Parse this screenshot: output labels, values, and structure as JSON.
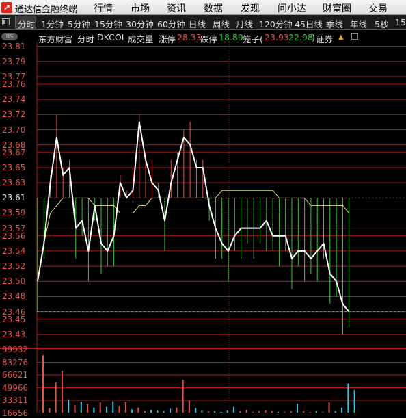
{
  "app": {
    "title": "通达信金融终端",
    "logo_icon": "tdx-logo-icon"
  },
  "menu": [
    "行情",
    "市场",
    "资讯",
    "数据",
    "发现",
    "问小达",
    "财富圈",
    "交易"
  ],
  "periods": [
    "分时",
    "1分钟",
    "5分钟",
    "15分钟",
    "30分钟",
    "60分钟",
    "日线",
    "周线",
    "月线",
    "120分钟",
    "45日线",
    "季线",
    "年线",
    "5秒",
    "15"
  ],
  "active_period": "分时",
  "info": {
    "badge": "BS",
    "broker": "东方财富",
    "mode": "分时",
    "code": "DKCOL",
    "volume_label": "成交量",
    "limit_up_label": "涨停",
    "limit_up": "28.33",
    "limit_down_label": "跌停",
    "limit_down": "18.89",
    "cage_label": "笼子(",
    "cage_low": "23.93",
    "cage_high": "22.98",
    "cage_close": ")",
    "cert_label": "证券",
    "up_down_icon": "up-down-arrow-icon",
    "edit_icon": "edit-icon"
  },
  "colors": {
    "price_line": "#ffffff",
    "avg_line": "#e0e07a",
    "up": "#e0554a",
    "down": "#3cc83c",
    "grid": "#b01818",
    "last_price": "#6a90d8"
  },
  "chart_data": {
    "type": "line",
    "ylim": [
      23.42,
      23.815
    ],
    "prev_close": 23.61,
    "last_price": 23.46,
    "y_ticks": [
      "23.81",
      "23.79",
      "23.77",
      "23.76",
      "23.74",
      "23.72",
      "23.70",
      "23.68",
      "23.67",
      "23.65",
      "23.63",
      "23.61",
      "23.59",
      "23.57",
      "23.56",
      "23.54",
      "23.52",
      "23.50",
      "23.48",
      "23.46",
      "23.45",
      "23.43"
    ],
    "series": [
      {
        "values": [
          23.5,
          23.55,
          23.63,
          23.69,
          23.64,
          23.65,
          23.57,
          23.58,
          23.54,
          23.6,
          23.55,
          23.54,
          23.56,
          23.63,
          23.61,
          23.62,
          23.71,
          23.66,
          23.63,
          23.62,
          23.58,
          23.63,
          23.66,
          23.69,
          23.68,
          23.65,
          23.65,
          23.6,
          23.57,
          23.55,
          23.54,
          23.56,
          23.57,
          23.57,
          23.57,
          23.57,
          23.58,
          23.56,
          23.56,
          23.56,
          23.53,
          23.54,
          23.54,
          23.53,
          23.54,
          23.55,
          23.51,
          23.5,
          23.47,
          23.46
        ]
      },
      {
        "values": [
          23.5,
          23.55,
          23.59,
          23.6,
          23.61,
          23.61,
          23.61,
          23.61,
          23.61,
          23.6,
          23.6,
          23.6,
          23.6,
          23.59,
          23.59,
          23.59,
          23.6,
          23.6,
          23.61,
          23.61,
          23.61,
          23.61,
          23.61,
          23.61,
          23.61,
          23.61,
          23.61,
          23.61,
          23.61,
          23.62,
          23.62,
          23.62,
          23.62,
          23.62,
          23.62,
          23.62,
          23.62,
          23.62,
          23.61,
          23.61,
          23.61,
          23.61,
          23.61,
          23.6,
          23.6,
          23.6,
          23.6,
          23.6,
          23.6,
          23.59
        ]
      }
    ],
    "volume_ticks": [
      "99932",
      "83276",
      "66621",
      "49966",
      "33311",
      "16656"
    ],
    "volume_max": 99932,
    "volume": [
      91000,
      7000,
      48000,
      66000,
      21000,
      12000,
      17000,
      14000,
      8000,
      16000,
      9000,
      18000,
      10000,
      17000,
      5000,
      8000,
      2000,
      4000,
      3000,
      2000,
      6000,
      8000,
      52000,
      19000,
      7000,
      3000,
      2000,
      2000,
      1000,
      3000,
      9000,
      2000,
      4000,
      1000,
      2000,
      3000,
      2000,
      1000,
      1000,
      2000,
      14000,
      2000,
      1000,
      2000,
      1000,
      16000,
      2000,
      8000,
      46000,
      36000
    ]
  }
}
